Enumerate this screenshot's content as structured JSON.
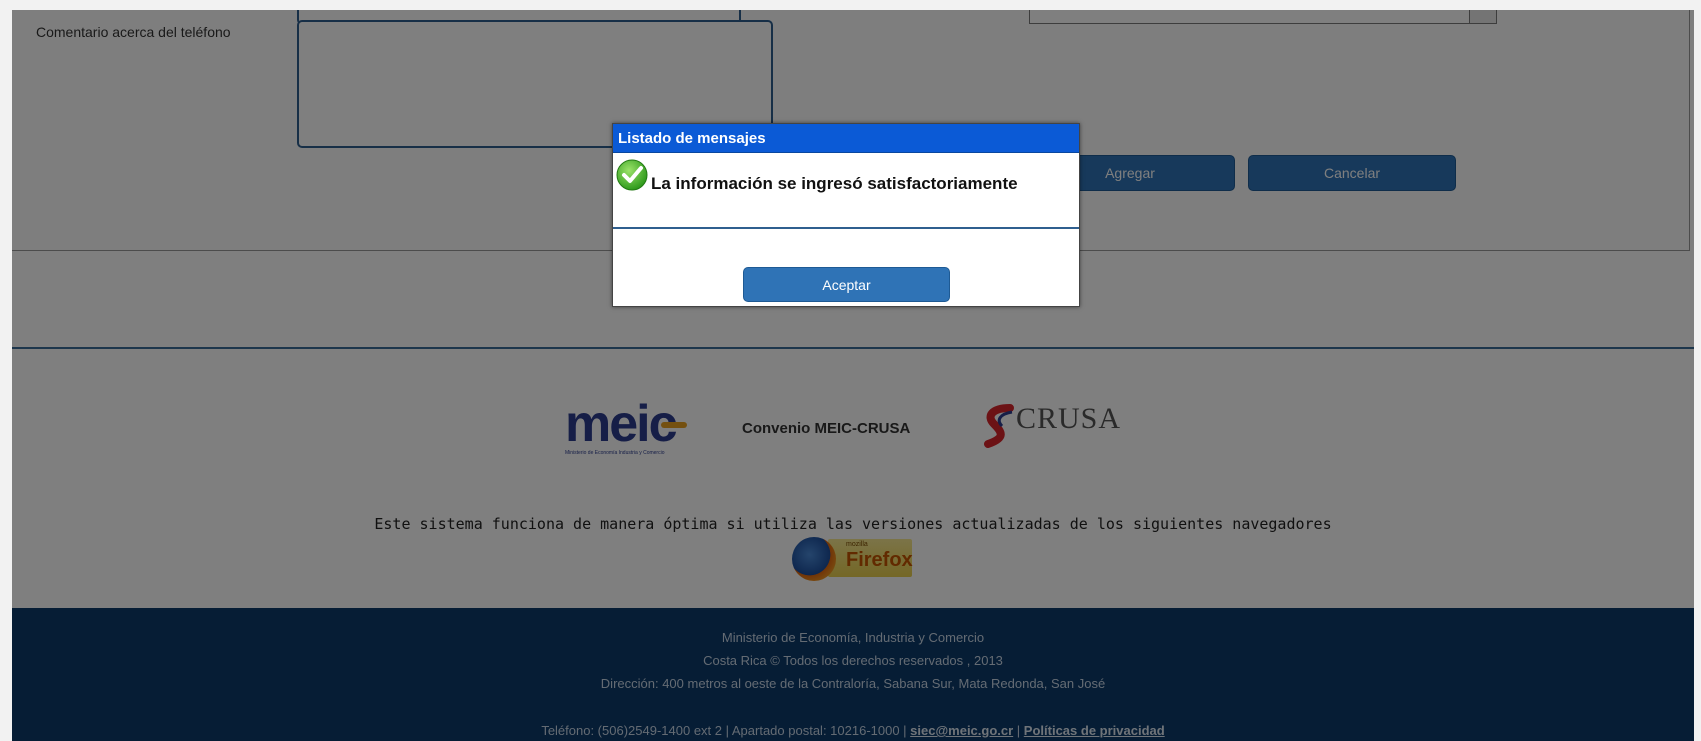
{
  "form": {
    "comment_label": "Comentario acerca del teléfono",
    "comment_value": "",
    "agregar_label": "Agregar",
    "cancelar_label": "Cancelar"
  },
  "footer": {
    "convenio": "Convenio MEIC-CRUSA",
    "meic_word": "meic",
    "meic_tag": "Ministerio de Economía Industria y Comercio",
    "crusa_word": "CRUSA",
    "browser_note": "Este sistema funciona de manera óptima si utiliza las versiones actualizadas de los siguientes navegadores",
    "firefox_small": "mozilla",
    "firefox_text": "Firefox",
    "line1": "Ministerio de Economía, Industria y Comercio",
    "line2": "Costa Rica © Todos los derechos reservados , 2013",
    "line3": "Dirección: 400 metros al oeste de la Contraloría, Sabana Sur, Mata Redonda, San José",
    "line4_prefix": "Teléfono: (506)2549-1400 ext 2 | Apartado postal: 10216-1000 | ",
    "email": "siec@meic.go.cr",
    "separator": " | ",
    "privacy": "Políticas de privacidad"
  },
  "modal": {
    "title": "Listado de mensajes",
    "message": "La información se ingresó satisfactoriamente",
    "accept_label": "Aceptar",
    "icon": "check-circle-icon",
    "accent_color": "#0b5ad6"
  },
  "colors": {
    "button_blue": "#2f73b6",
    "footer_blue": "#0c3a6b"
  }
}
